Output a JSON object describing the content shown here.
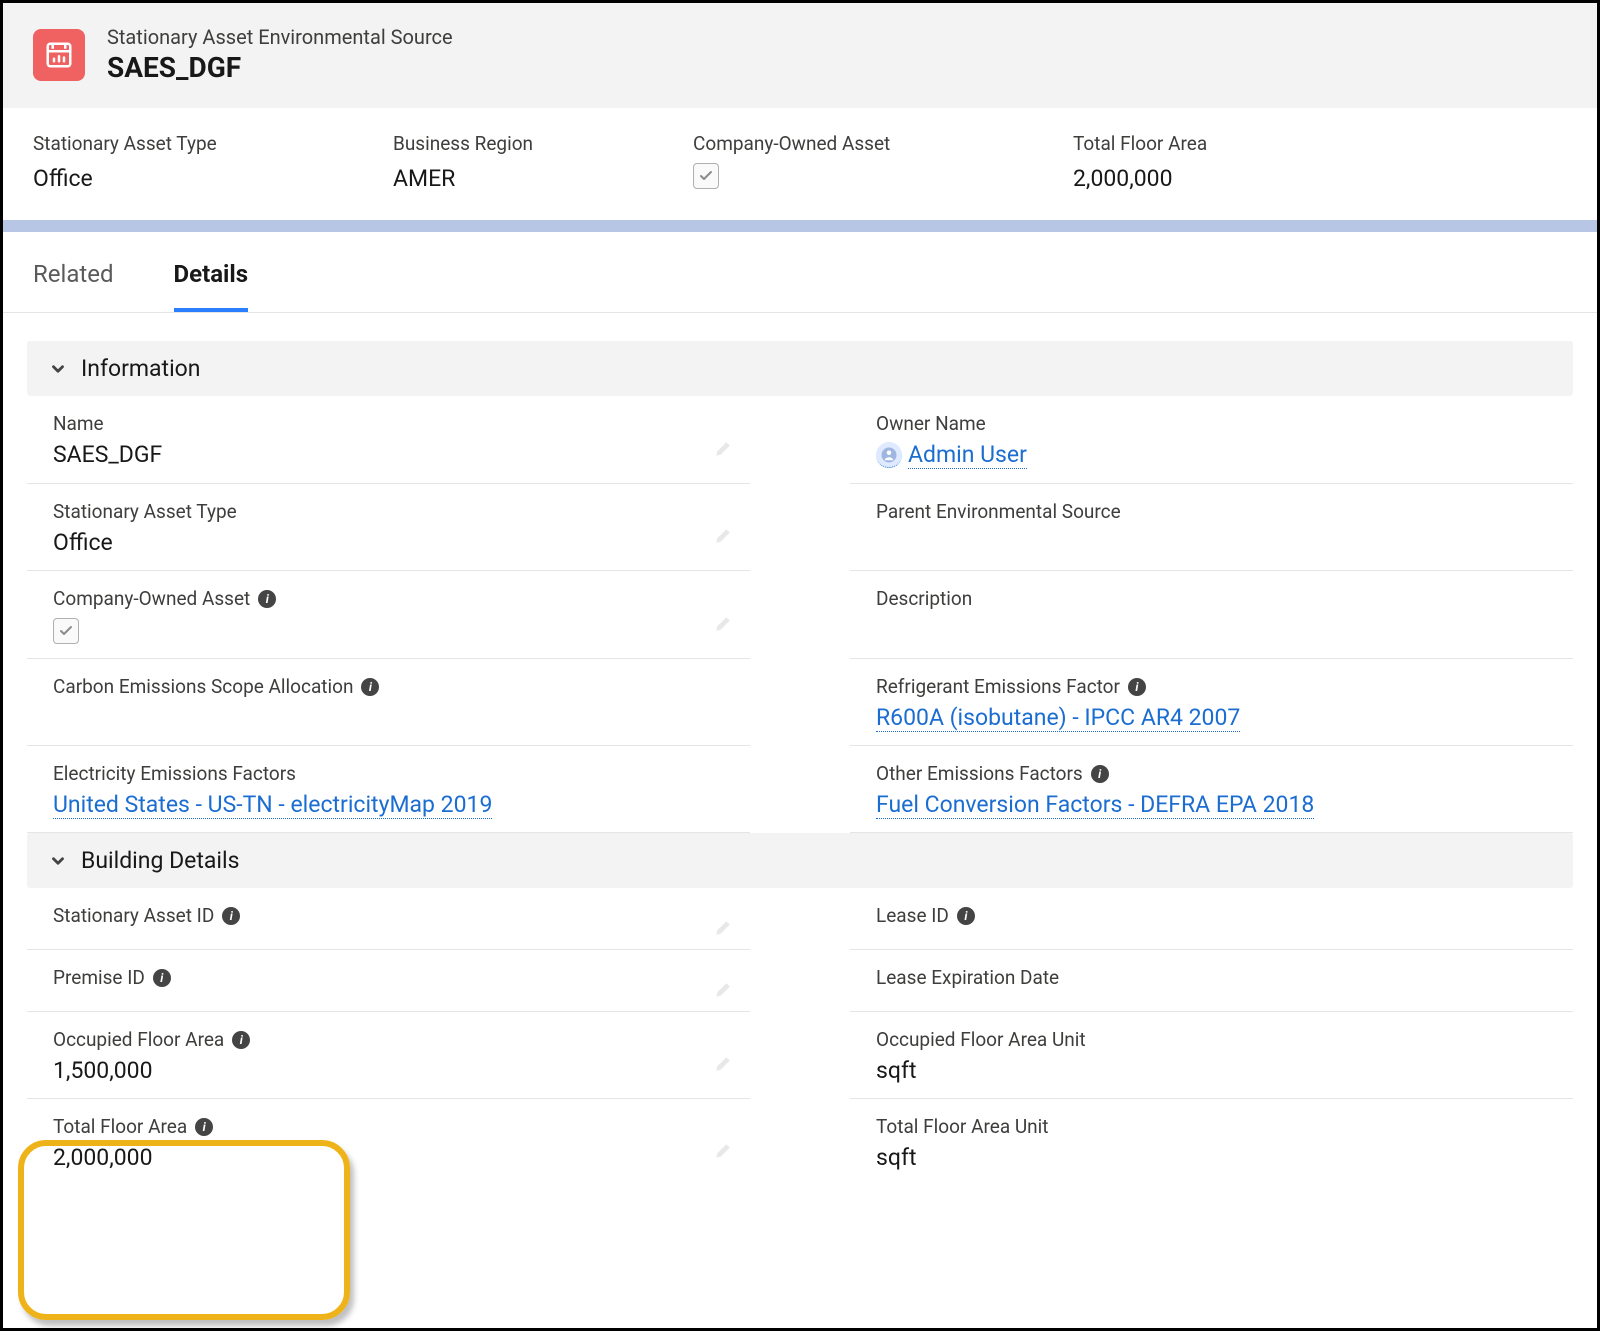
{
  "header": {
    "object_label": "Stationary Asset Environmental Source",
    "title": "SAES_DGF"
  },
  "highlights": {
    "asset_type_label": "Stationary Asset Type",
    "asset_type_value": "Office",
    "region_label": "Business Region",
    "region_value": "AMER",
    "company_owned_label": "Company-Owned Asset",
    "company_owned_checked": true,
    "total_floor_label": "Total Floor Area",
    "total_floor_value": "2,000,000"
  },
  "tabs": {
    "related": "Related",
    "details": "Details"
  },
  "sections": {
    "information": "Information",
    "building": "Building Details"
  },
  "info": {
    "name_label": "Name",
    "name_value": "SAES_DGF",
    "owner_label": "Owner Name",
    "owner_value": "Admin User",
    "asset_type_label": "Stationary Asset Type",
    "asset_type_value": "Office",
    "parent_label": "Parent Environmental Source",
    "parent_value": "",
    "company_owned_label": "Company-Owned Asset",
    "description_label": "Description",
    "description_value": "",
    "scope_label": "Carbon Emissions Scope Allocation",
    "scope_value": "",
    "refrigerant_label": "Refrigerant Emissions Factor",
    "refrigerant_value": "R600A (isobutane) - IPCC AR4 2007",
    "electricity_label": "Electricity Emissions Factors",
    "electricity_value": "United States - US-TN - electricityMap 2019",
    "other_label": "Other Emissions Factors",
    "other_value": "Fuel Conversion Factors - DEFRA EPA 2018"
  },
  "building": {
    "asset_id_label": "Stationary Asset ID",
    "asset_id_value": "",
    "lease_id_label": "Lease ID",
    "lease_id_value": "",
    "premise_id_label": "Premise ID",
    "premise_id_value": "",
    "lease_exp_label": "Lease Expiration Date",
    "lease_exp_value": "",
    "occupied_area_label": "Occupied Floor Area",
    "occupied_area_value": "1,500,000",
    "occupied_unit_label": "Occupied Floor Area Unit",
    "occupied_unit_value": "sqft",
    "total_area_label": "Total Floor Area",
    "total_area_value": "2,000,000",
    "total_unit_label": "Total Floor Area Unit",
    "total_unit_value": "sqft"
  }
}
